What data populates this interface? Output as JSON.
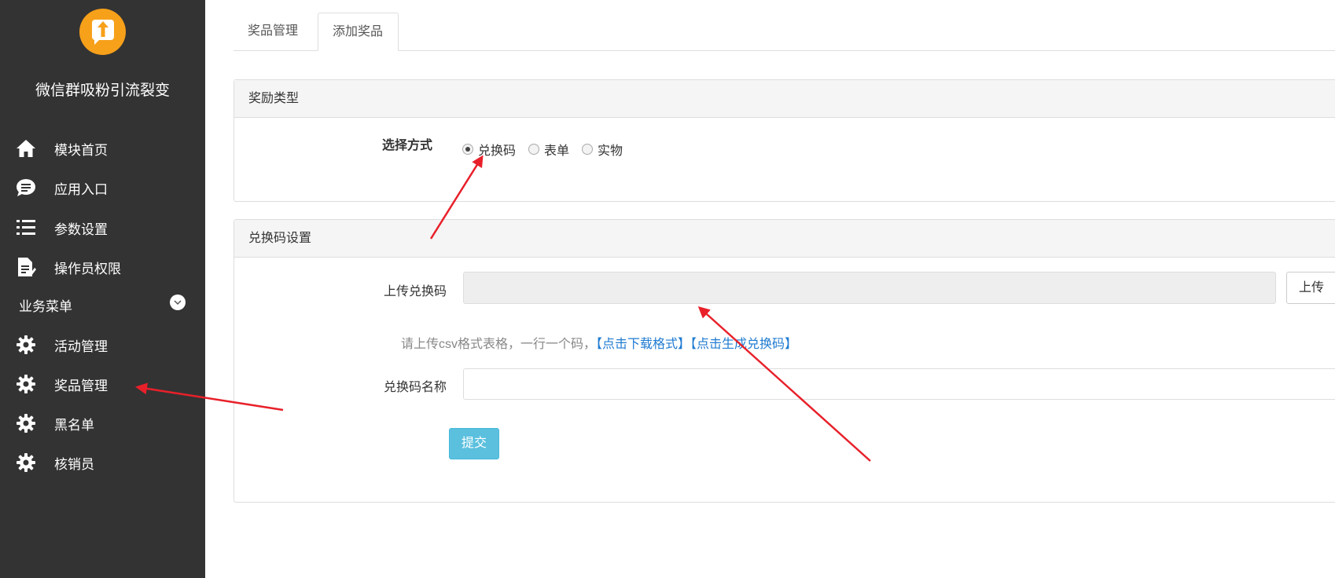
{
  "sidebar": {
    "app_title": "微信群吸粉引流裂变",
    "items": [
      {
        "label": "模块首页",
        "icon": "home-icon"
      },
      {
        "label": "应用入口",
        "icon": "chat-icon"
      },
      {
        "label": "参数设置",
        "icon": "list-icon"
      },
      {
        "label": "操作员权限",
        "icon": "document-edit-icon"
      }
    ],
    "section_label": "业务菜单",
    "section_items": [
      {
        "label": "活动管理",
        "icon": "gear-icon"
      },
      {
        "label": "奖品管理",
        "icon": "gear-icon"
      },
      {
        "label": "黑名单",
        "icon": "gear-icon"
      },
      {
        "label": "核销员",
        "icon": "gear-icon"
      }
    ]
  },
  "tabs": [
    {
      "label": "奖品管理",
      "active": false
    },
    {
      "label": "添加奖品",
      "active": true
    }
  ],
  "reward_panel": {
    "title": "奖励类型",
    "select_label": "选择方式",
    "options": [
      {
        "label": "兑换码",
        "checked": true
      },
      {
        "label": "表单",
        "checked": false
      },
      {
        "label": "实物",
        "checked": false
      }
    ]
  },
  "code_panel": {
    "title": "兑换码设置",
    "upload_label": "上传兑换码",
    "upload_value": "",
    "upload_button": "上传",
    "hint_text": "请上传csv格式表格，一行一个码，",
    "hint_link_download": "【点击下载格式】",
    "hint_link_generate": "【点击生成兑换码】",
    "name_label": "兑换码名称",
    "name_value": "",
    "submit": "提交"
  },
  "colors": {
    "sidebar_bg": "#333333",
    "logo": "#f7a01a",
    "link": "#1f7bd1",
    "submit": "#5bc0de",
    "annotation": "#e8202a"
  }
}
